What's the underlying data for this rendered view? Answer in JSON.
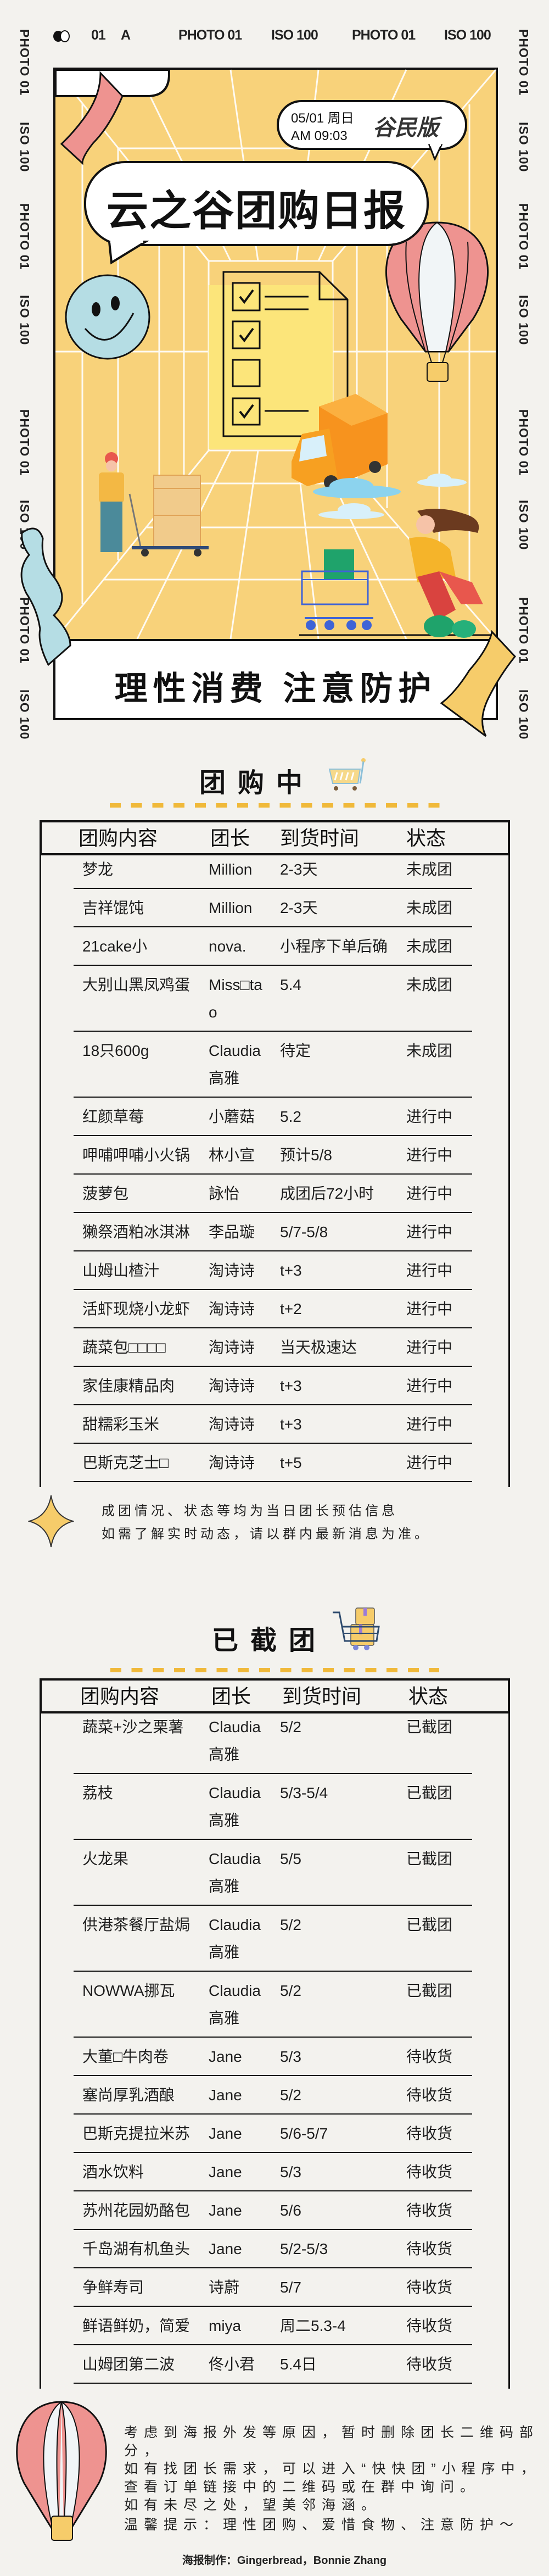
{
  "film_strip": {
    "frame_number": "01",
    "mode": "A",
    "top_labels": [
      "PHOTO 01",
      "ISO 100",
      "PHOTO 01",
      "ISO 100"
    ],
    "side_labels": [
      "PHOTO 01",
      "ISO 100",
      "PHOTO 01",
      "ISO 100",
      "PHOTO 01",
      "ISO 100",
      "PHOTO 01",
      "ISO 100"
    ]
  },
  "hero": {
    "date": "05/01 周日",
    "time": "AM 09:03",
    "edition": "谷民版",
    "title": "云之谷团购日报",
    "slogan": "理性消费 注意防护"
  },
  "active": {
    "heading": "团购中",
    "columns": [
      "团购内容",
      "团长",
      "到货时间",
      "状态"
    ],
    "rows": [
      {
        "item": "梦龙",
        "leader": "Million",
        "arrival": "2-3天",
        "status": "未成团"
      },
      {
        "item": "吉祥馄饨",
        "leader": "Million",
        "arrival": "2-3天",
        "status": "未成团"
      },
      {
        "item": "21cake小",
        "leader": "nova.",
        "arrival": "小程序下单后确",
        "status": "未成团"
      },
      {
        "item": "大别山黑凤鸡蛋",
        "leader": "Miss□ta\no",
        "arrival": "5.4",
        "status": "未成团"
      },
      {
        "item": "18只600g",
        "leader": "Claudia\n高雅",
        "arrival": "待定",
        "status": "未成团"
      },
      {
        "item": "红颜草莓",
        "leader": "小蘑菇",
        "arrival": "5.2",
        "status": "进行中"
      },
      {
        "item": "呷哺呷哺小火锅",
        "leader": "林小宣",
        "arrival": "预计5/8",
        "status": "进行中"
      },
      {
        "item": "菠萝包",
        "leader": "詠怡",
        "arrival": "成团后72小时",
        "status": "进行中"
      },
      {
        "item": "獭祭酒粕冰淇淋",
        "leader": "李品璇",
        "arrival": "5/7-5/8",
        "status": "进行中"
      },
      {
        "item": "山姆山楂汁",
        "leader": "淘诗诗",
        "arrival": "t+3",
        "status": "进行中"
      },
      {
        "item": "活虾现烧小龙虾",
        "leader": "淘诗诗",
        "arrival": "t+2",
        "status": "进行中"
      },
      {
        "item": "蔬菜包□□□□",
        "leader": "淘诗诗",
        "arrival": "当天极速达",
        "status": "进行中"
      },
      {
        "item": "家佳康精品肉",
        "leader": "淘诗诗",
        "arrival": "t+3",
        "status": "进行中"
      },
      {
        "item": "甜糯彩玉米",
        "leader": "淘诗诗",
        "arrival": "t+3",
        "status": "进行中"
      },
      {
        "item": "巴斯克芝士□",
        "leader": "淘诗诗",
        "arrival": "t+5",
        "status": "进行中"
      }
    ]
  },
  "note": {
    "lines": [
      "成团情况、状态等均为当日团长预估信息",
      "如需了解实时动态，请以群内最新消息为准。"
    ]
  },
  "closed": {
    "heading": "已截团",
    "columns": [
      "团购内容",
      "团长",
      "到货时间",
      "状态"
    ],
    "rows": [
      {
        "item": "蔬菜+沙之栗薯",
        "leader": "Claudia\n高雅",
        "arrival": "5/2",
        "status": "已截团"
      },
      {
        "item": "荔枝",
        "leader": "Claudia\n高雅",
        "arrival": "5/3-5/4",
        "status": "已截团"
      },
      {
        "item": "火龙果",
        "leader": "Claudia\n高雅",
        "arrival": "5/5",
        "status": "已截团"
      },
      {
        "item": "供港茶餐厅盐焗",
        "leader": "Claudia\n高雅",
        "arrival": "5/2",
        "status": "已截团"
      },
      {
        "item": "NOWWA挪瓦",
        "leader": "Claudia\n高雅",
        "arrival": "5/2",
        "status": "已截团"
      },
      {
        "item": "大董□牛肉卷",
        "leader": "Jane",
        "arrival": "5/3",
        "status": "待收货"
      },
      {
        "item": "塞尚厚乳酒酿",
        "leader": "Jane",
        "arrival": "5/2",
        "status": "待收货"
      },
      {
        "item": "巴斯克提拉米苏",
        "leader": "Jane",
        "arrival": "5/6-5/7",
        "status": "待收货"
      },
      {
        "item": "酒水饮料",
        "leader": "Jane",
        "arrival": "5/3",
        "status": "待收货"
      },
      {
        "item": "苏州花园奶酪包",
        "leader": "Jane",
        "arrival": "5/6",
        "status": "待收货"
      },
      {
        "item": "千岛湖有机鱼头",
        "leader": "Jane",
        "arrival": "5/2-5/3",
        "status": "待收货"
      },
      {
        "item": "争鲜寿司",
        "leader": "诗蔚",
        "arrival": "5/7",
        "status": "待收货"
      },
      {
        "item": "鲜语鲜奶，简爱",
        "leader": "miya",
        "arrival": "周二5.3-4",
        "status": "待收货"
      },
      {
        "item": "山姆团第二波",
        "leader": "佟小君",
        "arrival": "5.4日",
        "status": "待收货"
      }
    ]
  },
  "footer": {
    "lines": [
      "考虑到海报外发等原因，暂时删除团长二维码部分，",
      "如有找团长需求，可以进入“快快团”小程序中，",
      "查看订单链接中的二维码或在群中询问。",
      "如有未尽之处，望美邻海涵。"
    ],
    "tip": "温馨提示：理性团购、爱惜食物、注意防护～",
    "credit": "海报制作：Gingerbread，Bonnie Zhang"
  },
  "colors": {
    "background": "#F3F2EE",
    "hero_yellow": "#F8D27A",
    "accent_dash": "#F0B93A",
    "balloon_pink": "#EE9390",
    "smiley_blue": "#B5DDE4",
    "truck_orange": "#F7931E"
  }
}
